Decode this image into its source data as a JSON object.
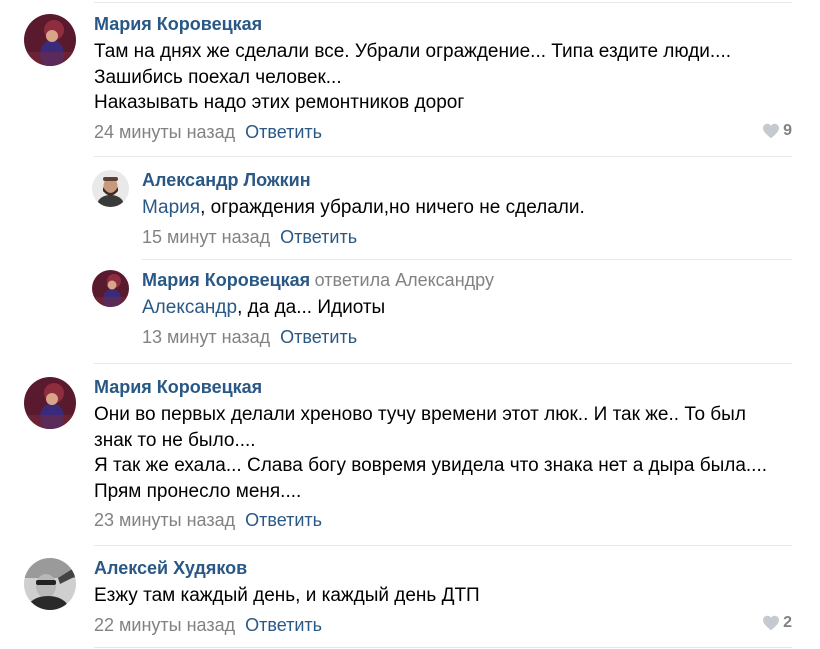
{
  "comments": [
    {
      "author": "Мария Коровецкая",
      "lines": [
        "Там на днях же сделали все. Убрали ограждение... Типа ездите люди....",
        "Зашибись поехал человек...",
        "Наказывать надо этих ремонтников дорог"
      ],
      "time": "24 минуты назад",
      "reply_label": "Ответить",
      "likes": "9"
    },
    {
      "author": "Александр Ложкин",
      "mention": "Мария",
      "text": ", ограждения убрали,но ничего не сделали.",
      "time": "15 минут назад",
      "reply_label": "Ответить"
    },
    {
      "author": "Мария Коровецкая",
      "replied_to": "ответила Александру",
      "mention": "Александр",
      "text": ", да да... Идиоты",
      "time": "13 минут назад",
      "reply_label": "Ответить"
    },
    {
      "author": "Мария Коровецкая",
      "lines": [
        "Они во первых делали хреново тучу времени этот люк.. И так же.. То был",
        "знак то не было....",
        "Я так же ехала... Слава богу вовремя увидела что знака нет а дыра была....",
        "Прям пронесло меня...."
      ],
      "time": "23 минуты назад",
      "reply_label": "Ответить"
    },
    {
      "author": "Алексей Худяков",
      "lines": [
        "Езжу там каждый день, и каждый день ДТП"
      ],
      "time": "22 минуты назад",
      "reply_label": "Ответить",
      "likes": "2"
    }
  ],
  "colors": {
    "link": "#2a5885",
    "muted": "#828282",
    "separator": "#e7e8ec",
    "heart": "#c5c9d0"
  }
}
